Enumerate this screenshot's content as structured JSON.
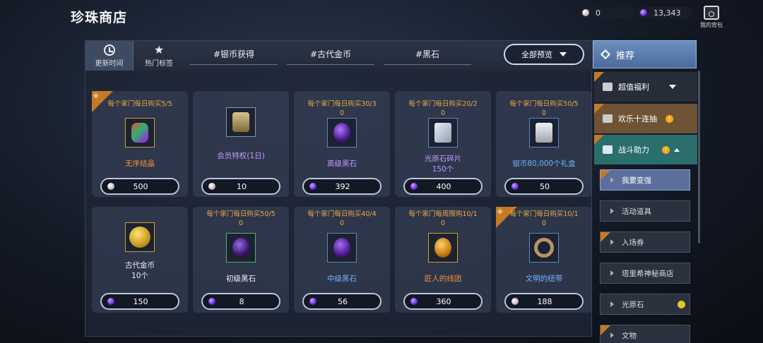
{
  "header": {
    "title": "珍珠商店"
  },
  "currency": {
    "pearl": "0",
    "gem": "13,343"
  },
  "bag": {
    "label": "我的背包"
  },
  "tabs": {
    "update_time": "更新时间",
    "hot_tags": "热门标签",
    "tag1": "#银币获得",
    "tag2": "#古代金币",
    "tag3": "#黑石",
    "preview": "全部预览"
  },
  "new_badge": "新",
  "items": [
    {
      "limit": "每个家门每日购买5/5",
      "limit2": "",
      "name": "无序结晶",
      "name2": "",
      "price": "500",
      "currency": "pearl",
      "new": true
    },
    {
      "limit": "",
      "limit2": "",
      "name": "会员特权(1日)",
      "name2": "",
      "price": "10",
      "currency": "pearl",
      "new": false
    },
    {
      "limit": "每个家门每日购买30/3",
      "limit2": "0",
      "name": "高级黑石",
      "name2": "",
      "price": "392",
      "currency": "gem",
      "new": false
    },
    {
      "limit": "每个家门每日购买20/2",
      "limit2": "0",
      "name": "光原石碎片",
      "name2": "150个",
      "price": "400",
      "currency": "gem",
      "new": false
    },
    {
      "limit": "每个家门每日购买50/5",
      "limit2": "0",
      "name": "银币80,000个礼盒",
      "name2": "",
      "price": "50",
      "currency": "gem",
      "new": false
    },
    {
      "limit": "",
      "limit2": "",
      "name": "古代金币",
      "name2": "10个",
      "price": "150",
      "currency": "gem",
      "new": false
    },
    {
      "limit": "每个家门每日购买50/5",
      "limit2": "0",
      "name": "初级黑石",
      "name2": "",
      "price": "8",
      "currency": "gem",
      "new": false
    },
    {
      "limit": "每个家门每日购买40/4",
      "limit2": "0",
      "name": "中级黑石",
      "name2": "",
      "price": "56",
      "currency": "gem",
      "new": false
    },
    {
      "limit": "每个家门每周限购10/1",
      "limit2": "0",
      "name": "匠人的线团",
      "name2": "",
      "price": "360",
      "currency": "gem",
      "new": false
    },
    {
      "limit": "每个家门每日购买10/1",
      "limit2": "0",
      "name": "文明的纽带",
      "name2": "",
      "price": "188",
      "currency": "pearl",
      "new": true
    }
  ],
  "sidebar": {
    "head": "推荐",
    "cat1": "超值福利",
    "cat2": "欢乐十连抽",
    "cat3": "战斗助力",
    "subs": [
      "我要变强",
      "活动道具",
      "入场券",
      "塔里希神秘商店",
      "光原石",
      "文物"
    ]
  }
}
